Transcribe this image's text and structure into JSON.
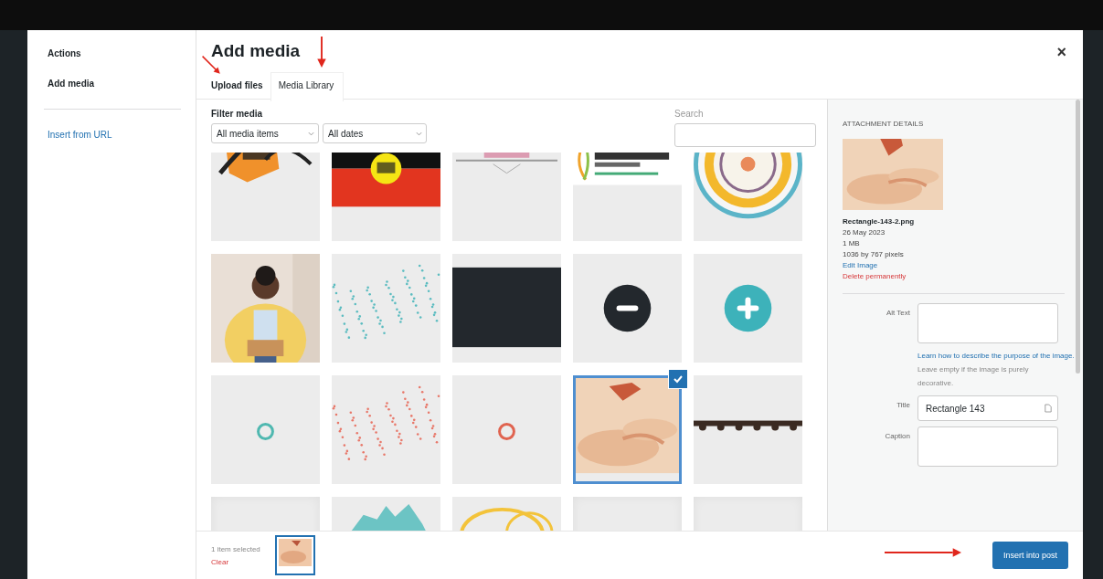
{
  "sidebar": {
    "heading": "Actions",
    "items": [
      {
        "label": "Add media",
        "selected": true
      }
    ],
    "link": "Insert from URL"
  },
  "modal": {
    "title": "Add media",
    "close": "×"
  },
  "tabs": [
    {
      "label": "Upload files",
      "selected": false
    },
    {
      "label": "Media Library",
      "selected": true
    }
  ],
  "filter": {
    "label": "Filter media",
    "type_select": "All media items",
    "date_select": "All dates",
    "search_label": "Search"
  },
  "thumbnails": [
    {
      "kind": "logo-brush",
      "selected": false
    },
    {
      "kind": "flag",
      "selected": false
    },
    {
      "kind": "logo-line",
      "selected": false
    },
    {
      "kind": "logo-leaf",
      "selected": false
    },
    {
      "kind": "mandala",
      "selected": false
    },
    {
      "kind": "photo-person",
      "selected": false
    },
    {
      "kind": "dots",
      "color": "#5bbcc0",
      "selected": false
    },
    {
      "kind": "dark",
      "selected": false
    },
    {
      "kind": "minus",
      "selected": false
    },
    {
      "kind": "plus",
      "selected": false
    },
    {
      "kind": "ring",
      "color": "#4fb8b0",
      "selected": false
    },
    {
      "kind": "dots",
      "color": "#e8786a",
      "selected": false
    },
    {
      "kind": "ring",
      "color": "#e0634f",
      "selected": false
    },
    {
      "kind": "photo-sand",
      "selected": true
    },
    {
      "kind": "edge",
      "selected": false
    },
    {
      "kind": "blank",
      "selected": false
    },
    {
      "kind": "map",
      "selected": false
    },
    {
      "kind": "rings",
      "selected": false
    },
    {
      "kind": "blank",
      "selected": false
    },
    {
      "kind": "blank",
      "selected": false
    }
  ],
  "details": {
    "heading": "ATTACHMENT DETAILS",
    "filename": "Rectangle-143-2.png",
    "date": "26 May 2023",
    "size": "1 MB",
    "dimensions": "1036 by 767 pixels",
    "edit_link": "Edit Image",
    "delete_link": "Delete permanently",
    "fields": [
      {
        "kind": "textarea",
        "label": "Alt Text"
      },
      {
        "kind": "help",
        "link": "Learn how to describe the purpose of the image.",
        "text": " Leave empty if the image is purely decorative."
      },
      {
        "kind": "input",
        "label": "Title",
        "value": "Rectangle 143"
      },
      {
        "kind": "textarea",
        "label": "Caption"
      }
    ]
  },
  "footer": {
    "count": "1 item selected",
    "clear": "Clear",
    "button": "Insert into post"
  }
}
